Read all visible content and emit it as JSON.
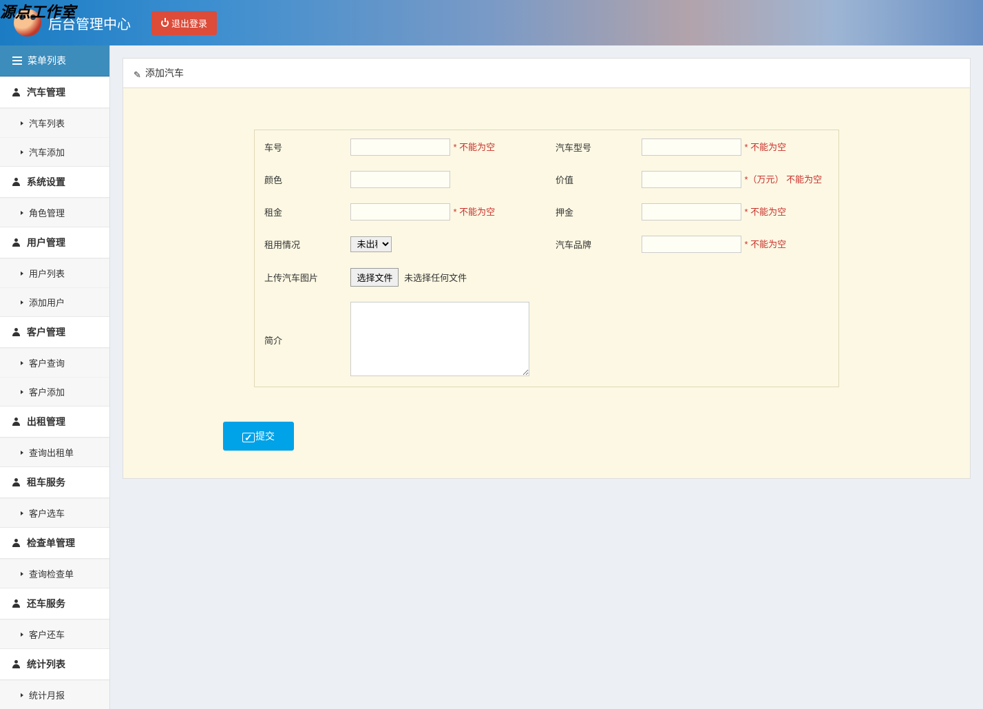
{
  "watermark": "源点工作室",
  "header": {
    "brand": "后台管理中心",
    "logout": "退出登录"
  },
  "sidebar": {
    "title": "菜单列表",
    "sections": [
      {
        "label": "汽车管理",
        "items": [
          "汽车列表",
          "汽车添加"
        ]
      },
      {
        "label": "系统设置",
        "items": [
          "角色管理"
        ]
      },
      {
        "label": "用户管理",
        "items": [
          "用户列表",
          "添加用户"
        ]
      },
      {
        "label": "客户管理",
        "items": [
          "客户查询",
          "客户添加"
        ]
      },
      {
        "label": "出租管理",
        "items": [
          "查询出租单"
        ]
      },
      {
        "label": "租车服务",
        "items": [
          "客户选车"
        ]
      },
      {
        "label": "检查单管理",
        "items": [
          "查询检查单"
        ]
      },
      {
        "label": "还车服务",
        "items": [
          "客户还车"
        ]
      },
      {
        "label": "统计列表",
        "items": [
          "统计月报"
        ]
      }
    ]
  },
  "panel": {
    "title": "添加汽车"
  },
  "form": {
    "car_number": {
      "label": "车号",
      "hint": "* 不能为空"
    },
    "car_model": {
      "label": "汽车型号",
      "hint": "* 不能为空"
    },
    "color": {
      "label": "颜色"
    },
    "value": {
      "label": "价值",
      "hint": "*（万元） 不能为空"
    },
    "rent": {
      "label": "租金",
      "hint": "* 不能为空"
    },
    "deposit": {
      "label": "押金",
      "hint": "* 不能为空"
    },
    "rent_status": {
      "label": "租用情况",
      "selected": "未出租"
    },
    "brand": {
      "label": "汽车品牌",
      "hint": "* 不能为空"
    },
    "upload": {
      "label": "上传汽车图片",
      "button": "选择文件",
      "no_file": "未选择任何文件"
    },
    "intro": {
      "label": "简介"
    },
    "submit": "提交"
  }
}
